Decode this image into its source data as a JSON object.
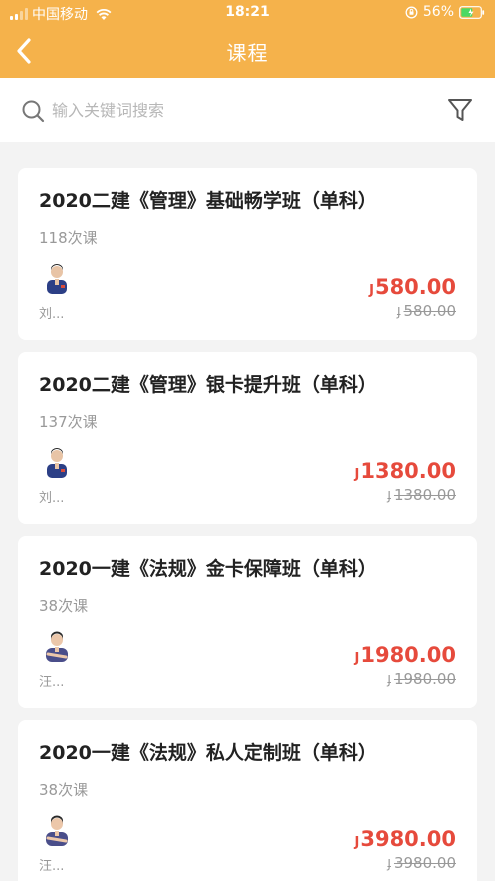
{
  "status_bar": {
    "carrier": "中国移动",
    "time": "18:21",
    "battery": "56%"
  },
  "nav": {
    "title": "课程",
    "back_icon": "chevron-left-icon"
  },
  "search": {
    "placeholder": "输入关键词搜索",
    "value": "",
    "filter_icon": "filter-icon"
  },
  "colors": {
    "header": "#f5b24b",
    "price": "#e64a3c",
    "background": "#f3f3f3"
  },
  "courses": [
    {
      "title": "2020二建《管理》基础畅学班（单科）",
      "lessons": "118次课",
      "teacher": "刘...",
      "currency_symbol": "J",
      "price": "580.00",
      "original_price": "580.00"
    },
    {
      "title": "2020二建《管理》银卡提升班（单科）",
      "lessons": "137次课",
      "teacher": "刘...",
      "currency_symbol": "J",
      "price": "1380.00",
      "original_price": "1380.00"
    },
    {
      "title": "2020一建《法规》金卡保障班（单科）",
      "lessons": "38次课",
      "teacher": "汪...",
      "currency_symbol": "J",
      "price": "1980.00",
      "original_price": "1980.00"
    },
    {
      "title": "2020一建《法规》私人定制班（单科）",
      "lessons": "38次课",
      "teacher": "汪...",
      "currency_symbol": "J",
      "price": "3980.00",
      "original_price": "3980.00"
    }
  ]
}
